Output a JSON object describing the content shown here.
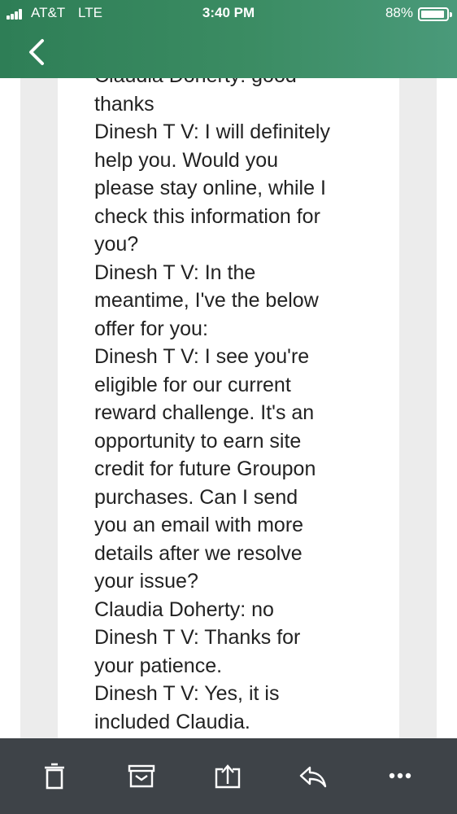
{
  "status_bar": {
    "carrier": "AT&T",
    "network": "LTE",
    "time": "3:40 PM",
    "battery": "88%",
    "battery_level": 0.88
  },
  "header": {
    "back_icon": "chevron-left-icon",
    "background": "#3b8c63"
  },
  "transcript_text": "Claudia Doherty: good\nthanks\nDinesh T V: I will definitely\nhelp you. Would you\nplease stay online, while I\ncheck this information for\nyou?\nDinesh T V: In the\nmeantime, I've the below\noffer for you:\nDinesh T V: I see you're\neligible for our current\nreward challenge. It's an\nopportunity to earn site\ncredit for future Groupon\npurchases. Can I send\nyou an email with more\ndetails after we resolve\nyour issue?\nClaudia Doherty: no\nDinesh T V: Thanks for\nyour patience.\nDinesh T V: Yes, it is\nincluded Claudia.",
  "toolbar": {
    "icons": [
      "trash-icon",
      "archive-icon",
      "share-icon",
      "reply-icon",
      "more-icon"
    ],
    "background": "#3e4348"
  }
}
